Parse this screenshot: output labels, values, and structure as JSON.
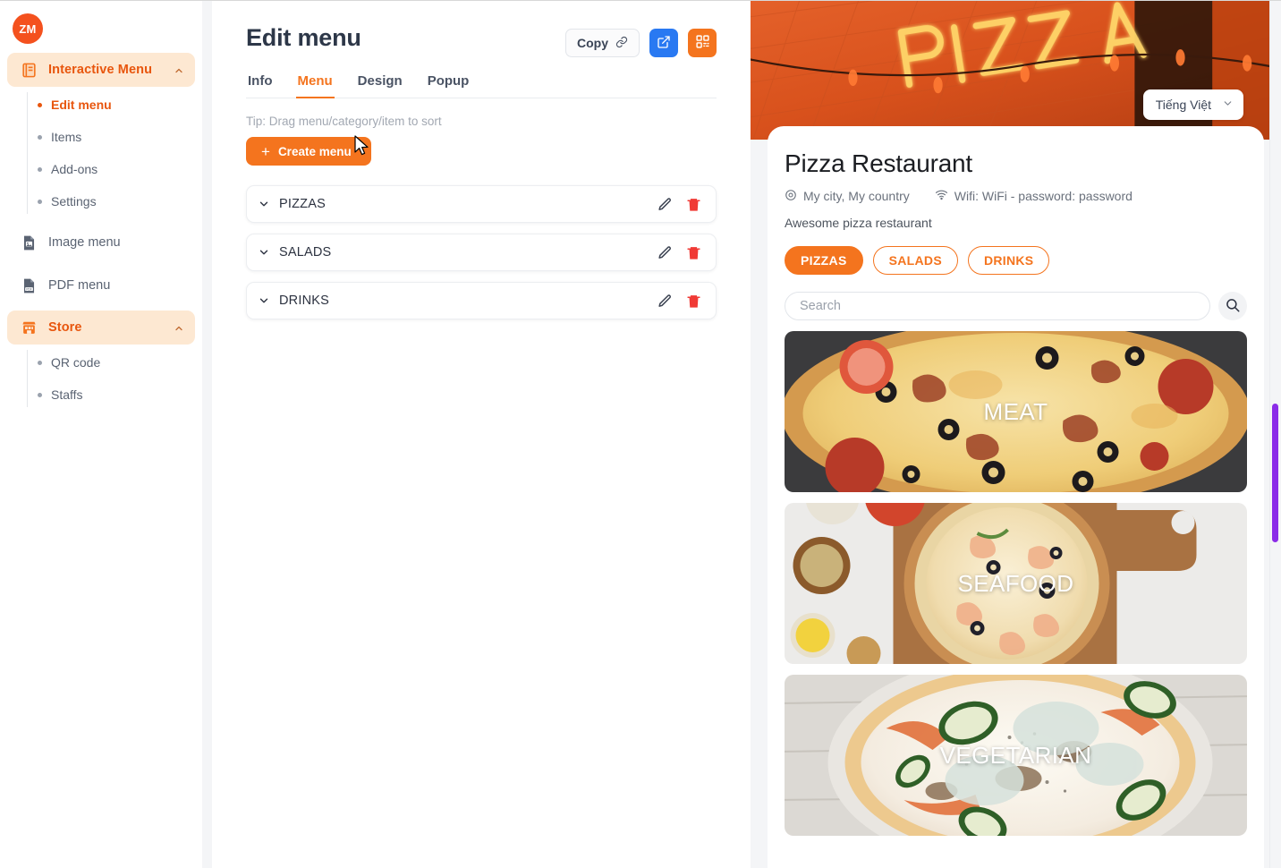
{
  "brand": {
    "logo_text": "ZM"
  },
  "sidebar": {
    "groups": [
      {
        "label": "Interactive Menu",
        "icon": "book-icon",
        "expanded": true,
        "items": [
          {
            "label": "Edit menu",
            "active": true
          },
          {
            "label": "Items",
            "active": false
          },
          {
            "label": "Add-ons",
            "active": false
          },
          {
            "label": "Settings",
            "active": false
          }
        ]
      }
    ],
    "links": [
      {
        "label": "Image menu",
        "icon": "image-file-icon"
      },
      {
        "label": "PDF menu",
        "icon": "pdf-file-icon"
      }
    ],
    "store_group": {
      "label": "Store",
      "icon": "store-icon",
      "expanded": true,
      "items": [
        {
          "label": "QR code",
          "active": false
        },
        {
          "label": "Staffs",
          "active": false
        }
      ]
    }
  },
  "editor": {
    "title": "Edit menu",
    "copy_label": "Copy",
    "copy_icon": "link-icon",
    "open_icon": "external-link-icon",
    "qr_icon": "qr-code-icon",
    "tabs": [
      {
        "label": "Info",
        "active": false
      },
      {
        "label": "Menu",
        "active": true
      },
      {
        "label": "Design",
        "active": false
      },
      {
        "label": "Popup",
        "active": false
      }
    ],
    "tip": "Tip: Drag menu/category/item to sort",
    "create_button": "Create menu",
    "menu_rows": [
      {
        "name": "PIZZAS",
        "edit_icon": "pencil-icon",
        "delete_icon": "trash-icon"
      },
      {
        "name": "SALADS",
        "edit_icon": "pencil-icon",
        "delete_icon": "trash-icon"
      },
      {
        "name": "DRINKS",
        "edit_icon": "pencil-icon",
        "delete_icon": "trash-icon"
      }
    ]
  },
  "preview": {
    "language": "Tiếng Việt",
    "restaurant_name": "Pizza Restaurant",
    "location": "My city, My country",
    "location_icon": "map-pin-icon",
    "wifi": "Wifi: WiFi - password: password",
    "wifi_icon": "wifi-icon",
    "description": "Awesome pizza restaurant",
    "categories": [
      {
        "label": "PIZZAS",
        "active": true
      },
      {
        "label": "SALADS",
        "active": false
      },
      {
        "label": "DRINKS",
        "active": false
      }
    ],
    "search_placeholder": "Search",
    "search_value": "",
    "search_icon": "search-icon",
    "cards": [
      {
        "label": "MEAT"
      },
      {
        "label": "SEAFOOD"
      },
      {
        "label": "VEGETARIAN"
      }
    ]
  },
  "colors": {
    "accent": "#f4741e",
    "accent_dark": "#e8560e",
    "accent_soft": "#fde8d2",
    "blue": "#2979f2",
    "red": "#f03a35",
    "scrollbar": "#8b2ce8"
  }
}
